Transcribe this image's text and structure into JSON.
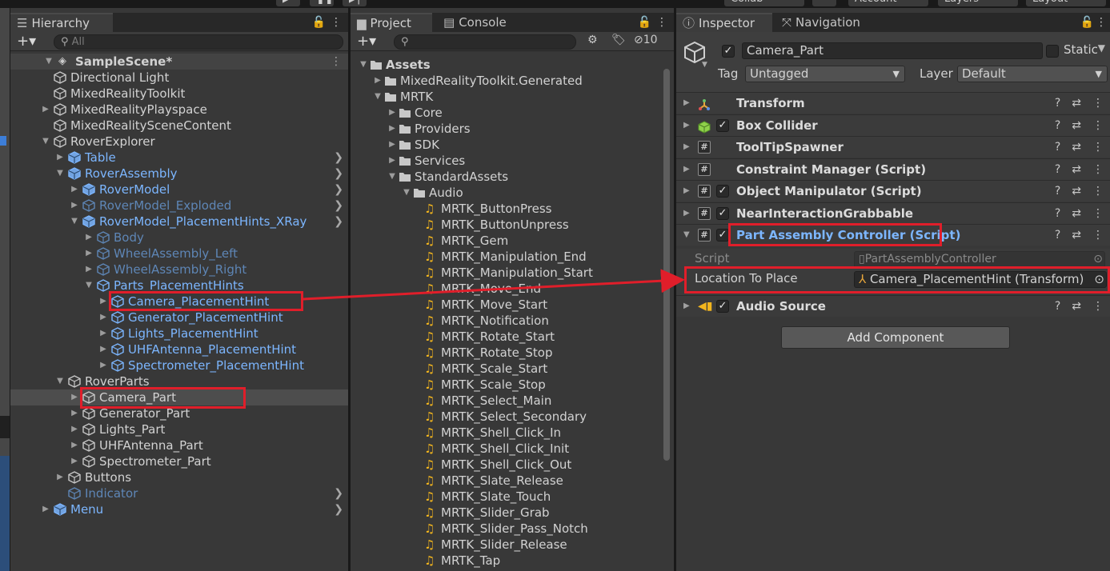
{
  "toolbar": {
    "collab": "Collab",
    "account": "Account",
    "layers": "Layers",
    "layout": "Layout"
  },
  "hierarchy": {
    "tab": "Hierarchy",
    "search_placeholder": "All",
    "scene": "SampleScene*",
    "items": [
      {
        "label": "Directional Light",
        "depth": 1,
        "style": "normal"
      },
      {
        "label": "MixedRealityToolkit",
        "depth": 1,
        "style": "normal"
      },
      {
        "label": "MixedRealityPlayspace",
        "depth": 1,
        "style": "normal",
        "arrow": "right"
      },
      {
        "label": "MixedRealitySceneContent",
        "depth": 1,
        "style": "normal"
      },
      {
        "label": "RoverExplorer",
        "depth": 1,
        "style": "normal",
        "arrow": "down"
      },
      {
        "label": "Table",
        "depth": 2,
        "style": "blue",
        "arrow": "right",
        "chev": true
      },
      {
        "label": "RoverAssembly",
        "depth": 2,
        "style": "blue",
        "arrow": "down",
        "chev": true
      },
      {
        "label": "RoverModel",
        "depth": 3,
        "style": "blue",
        "arrow": "right",
        "chev": true
      },
      {
        "label": "RoverModel_Exploded",
        "depth": 3,
        "style": "dim",
        "arrow": "right",
        "chev": true
      },
      {
        "label": "RoverModel_PlacementHints_XRay",
        "depth": 3,
        "style": "blue",
        "arrow": "down",
        "chev": true
      },
      {
        "label": "Body",
        "depth": 4,
        "style": "dim",
        "arrow": "right"
      },
      {
        "label": "WheelAssembly_Left",
        "depth": 4,
        "style": "dim",
        "arrow": "right"
      },
      {
        "label": "WheelAssembly_Right",
        "depth": 4,
        "style": "dim",
        "arrow": "right"
      },
      {
        "label": "Parts_PlacementHints",
        "depth": 4,
        "style": "blue",
        "arrow": "down"
      },
      {
        "label": "Camera_PlacementHint",
        "depth": 5,
        "style": "blue",
        "arrow": "right"
      },
      {
        "label": "Generator_PlacementHint",
        "depth": 5,
        "style": "blue",
        "arrow": "right"
      },
      {
        "label": "Lights_PlacementHint",
        "depth": 5,
        "style": "blue",
        "arrow": "right"
      },
      {
        "label": "UHFAntenna_PlacementHint",
        "depth": 5,
        "style": "blue",
        "arrow": "right"
      },
      {
        "label": "Spectrometer_PlacementHint",
        "depth": 5,
        "style": "blue",
        "arrow": "right"
      },
      {
        "label": "RoverParts",
        "depth": 2,
        "style": "normal",
        "arrow": "down"
      },
      {
        "label": "Camera_Part",
        "depth": 3,
        "style": "normal",
        "arrow": "right",
        "selected": true
      },
      {
        "label": "Generator_Part",
        "depth": 3,
        "style": "normal",
        "arrow": "right"
      },
      {
        "label": "Lights_Part",
        "depth": 3,
        "style": "normal",
        "arrow": "right"
      },
      {
        "label": "UHFAntenna_Part",
        "depth": 3,
        "style": "normal",
        "arrow": "right"
      },
      {
        "label": "Spectrometer_Part",
        "depth": 3,
        "style": "normal",
        "arrow": "right"
      },
      {
        "label": "Buttons",
        "depth": 2,
        "style": "normal",
        "arrow": "right"
      },
      {
        "label": "Indicator",
        "depth": 2,
        "style": "dim",
        "chev": true
      },
      {
        "label": "Menu",
        "depth": 1,
        "style": "blue",
        "arrow": "right",
        "chev": true
      }
    ]
  },
  "project": {
    "tab_project": "Project",
    "tab_console": "Console",
    "hidden_count": "10",
    "folders": [
      {
        "label": "Assets",
        "depth": 0,
        "arrow": "down"
      },
      {
        "label": "MixedRealityToolkit.Generated",
        "depth": 1,
        "arrow": "right"
      },
      {
        "label": "MRTK",
        "depth": 1,
        "arrow": "down"
      },
      {
        "label": "Core",
        "depth": 2,
        "arrow": "right"
      },
      {
        "label": "Providers",
        "depth": 2,
        "arrow": "right"
      },
      {
        "label": "SDK",
        "depth": 2,
        "arrow": "right"
      },
      {
        "label": "Services",
        "depth": 2,
        "arrow": "right"
      },
      {
        "label": "StandardAssets",
        "depth": 2,
        "arrow": "down"
      },
      {
        "label": "Audio",
        "depth": 3,
        "arrow": "down"
      }
    ],
    "audio_files": [
      "MRTK_ButtonPress",
      "MRTK_ButtonUnpress",
      "MRTK_Gem",
      "MRTK_Manipulation_End",
      "MRTK_Manipulation_Start",
      "MRTK_Move_End",
      "MRTK_Move_Start",
      "MRTK_Notification",
      "MRTK_Rotate_Start",
      "MRTK_Rotate_Stop",
      "MRTK_Scale_Start",
      "MRTK_Scale_Stop",
      "MRTK_Select_Main",
      "MRTK_Select_Secondary",
      "MRTK_Shell_Click_In",
      "MRTK_Shell_Click_Init",
      "MRTK_Shell_Click_Out",
      "MRTK_Slate_Release",
      "MRTK_Slate_Touch",
      "MRTK_Slider_Grab",
      "MRTK_Slider_Pass_Notch",
      "MRTK_Slider_Release",
      "MRTK_Tap"
    ]
  },
  "inspector": {
    "tab_inspector": "Inspector",
    "tab_navigation": "Navigation",
    "object_name": "Camera_Part",
    "static_label": "Static",
    "tag_label": "Tag",
    "tag_value": "Untagged",
    "layer_label": "Layer",
    "layer_value": "Default",
    "components": [
      {
        "name": "Transform",
        "icon": "transform-icon",
        "checkbox": false
      },
      {
        "name": "Box Collider",
        "icon": "box-collider-icon",
        "checkbox": true
      },
      {
        "name": "ToolTipSpawner",
        "icon": "script-icon",
        "checkbox": false
      },
      {
        "name": "Constraint Manager (Script)",
        "icon": "script-icon",
        "checkbox": false
      },
      {
        "name": "Object Manipulator (Script)",
        "icon": "script-icon",
        "checkbox": true
      },
      {
        "name": "NearInteractionGrabbable",
        "icon": "script-icon",
        "checkbox": true
      },
      {
        "name": "Part Assembly Controller (Script)",
        "icon": "script-icon",
        "checkbox": true,
        "expanded": true
      }
    ],
    "script_label": "Script",
    "script_value": "PartAssemblyController",
    "location_label": "Location To Place",
    "location_value": "Camera_PlacementHint (Transform)",
    "audio_source": "Audio Source",
    "add_component": "Add Component"
  },
  "colors": {
    "highlight": "#e01e2a",
    "prefab_blue": "#7cb6ff",
    "audio_orange": "#f2b51e"
  }
}
